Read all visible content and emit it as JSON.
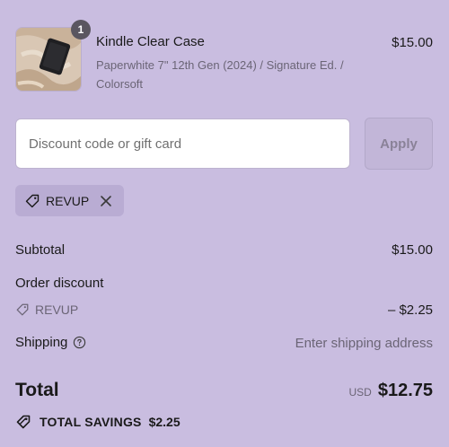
{
  "item": {
    "quantity": "1",
    "name": "Kindle Clear Case",
    "variant": "Paperwhite 7\" 12th Gen (2024) / Signature Ed. / Colorsoft",
    "price": "$15.00"
  },
  "discount": {
    "placeholder": "Discount code or gift card",
    "value": "",
    "apply_label": "Apply",
    "applied_code": "REVUP"
  },
  "summary": {
    "subtotal_label": "Subtotal",
    "subtotal_value": "$15.00",
    "order_discount_label": "Order discount",
    "discount_code": "REVUP",
    "discount_value": "– $2.25",
    "shipping_label": "Shipping",
    "shipping_value": "Enter shipping address",
    "total_label": "Total",
    "currency": "USD",
    "total_value": "$12.75",
    "savings_label": "TOTAL SAVINGS",
    "savings_value": "$2.25"
  },
  "colors": {
    "background": "#c9bde0",
    "chip": "#b9acd3",
    "badge": "#5a5660"
  },
  "icons": [
    "tag-icon",
    "close-icon",
    "help-circle-icon",
    "savings-tag-icon"
  ]
}
